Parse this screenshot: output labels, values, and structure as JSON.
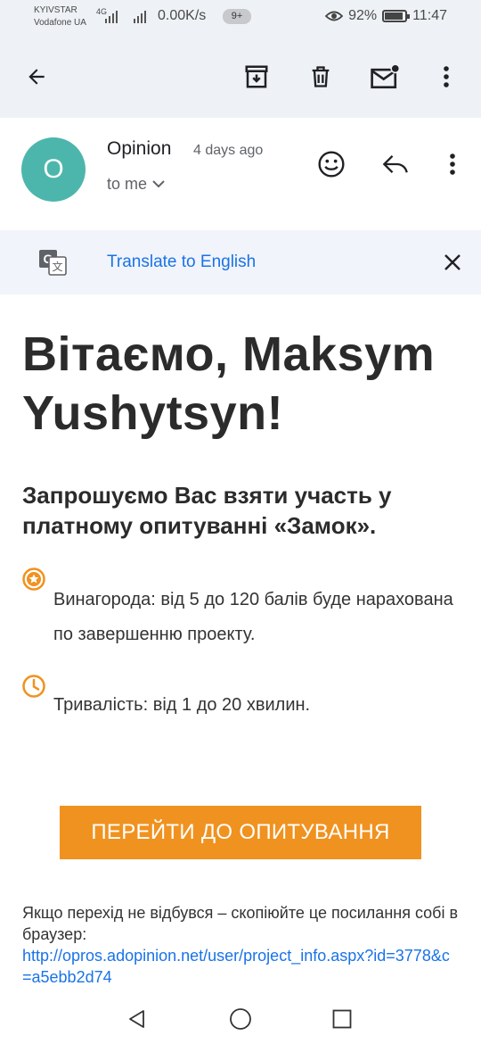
{
  "status_bar": {
    "carrier_1": "KYIVSTAR",
    "carrier_2": "Vodafone UA",
    "network_type": "4G",
    "speed": "0.00K/s",
    "notifications": "9+",
    "battery": "92%",
    "time": "11:47"
  },
  "toolbar": {
    "back_icon": "arrow-left-icon",
    "archive_icon": "archive-icon",
    "delete_icon": "trash-icon",
    "mark_unread_icon": "mail-unread-icon",
    "more_icon": "more-vert-icon"
  },
  "email": {
    "avatar_letter": "O",
    "avatar_color": "#4db6ac",
    "sender": "Opinion",
    "time": "4 days ago",
    "recipient": "to me",
    "react_icon": "emoji-icon",
    "reply_icon": "reply-icon",
    "more_icon": "more-vert-icon"
  },
  "translate": {
    "link": "Translate to English",
    "translate_icon": "translate-icon",
    "close_icon": "close-icon"
  },
  "body": {
    "heading": "Вітаємо, Maksym Yushytsyn!",
    "subheading": "Запрошуємо Вас взяти участь у платному опитуванні «Замок».",
    "reward": "Винагорода: від 5 до 120 балів буде нарахована по завершенню проекту.",
    "duration": "Тривалість: від 1 до 20 хвилин.",
    "cta": "ПЕРЕЙТИ ДО ОПИТУВАННЯ",
    "cta_color": "#f0921f",
    "fallback": "Якщо перехід не відбувся – скопіюйте це посилання собі в браузер:",
    "link": "http://opros.adopinion.net/user/project_info.aspx?id=3778&c=a5ebb2d74"
  },
  "navbar": {
    "back_icon": "nav-back-icon",
    "home_icon": "nav-home-icon",
    "recents_icon": "nav-recents-icon"
  }
}
